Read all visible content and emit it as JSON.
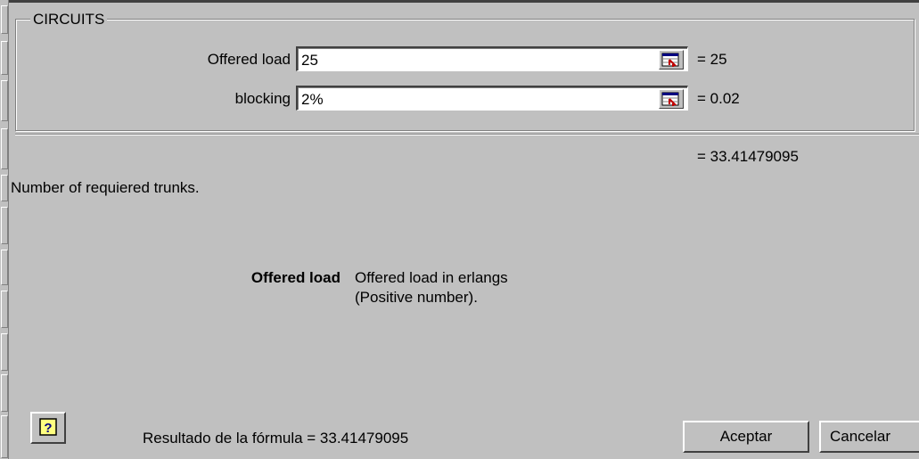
{
  "dialog": {
    "group_title": "CIRCUITS",
    "arguments": [
      {
        "label": "Offered load",
        "value": "25",
        "evaluated": "= 25"
      },
      {
        "label": "blocking",
        "value": "2%",
        "evaluated": "= 0.02"
      }
    ],
    "function_result": "= 33.41479095",
    "function_description": "Number of requiered trunks.",
    "help_argument_name": "Offered load",
    "help_argument_text_line1": "Offered load in erlangs",
    "help_argument_text_line2": "(Positive number).",
    "formula_result": "Resultado de la fórmula = 33.41479095",
    "accept_label": "Aceptar",
    "cancel_label": "Cancelar"
  }
}
